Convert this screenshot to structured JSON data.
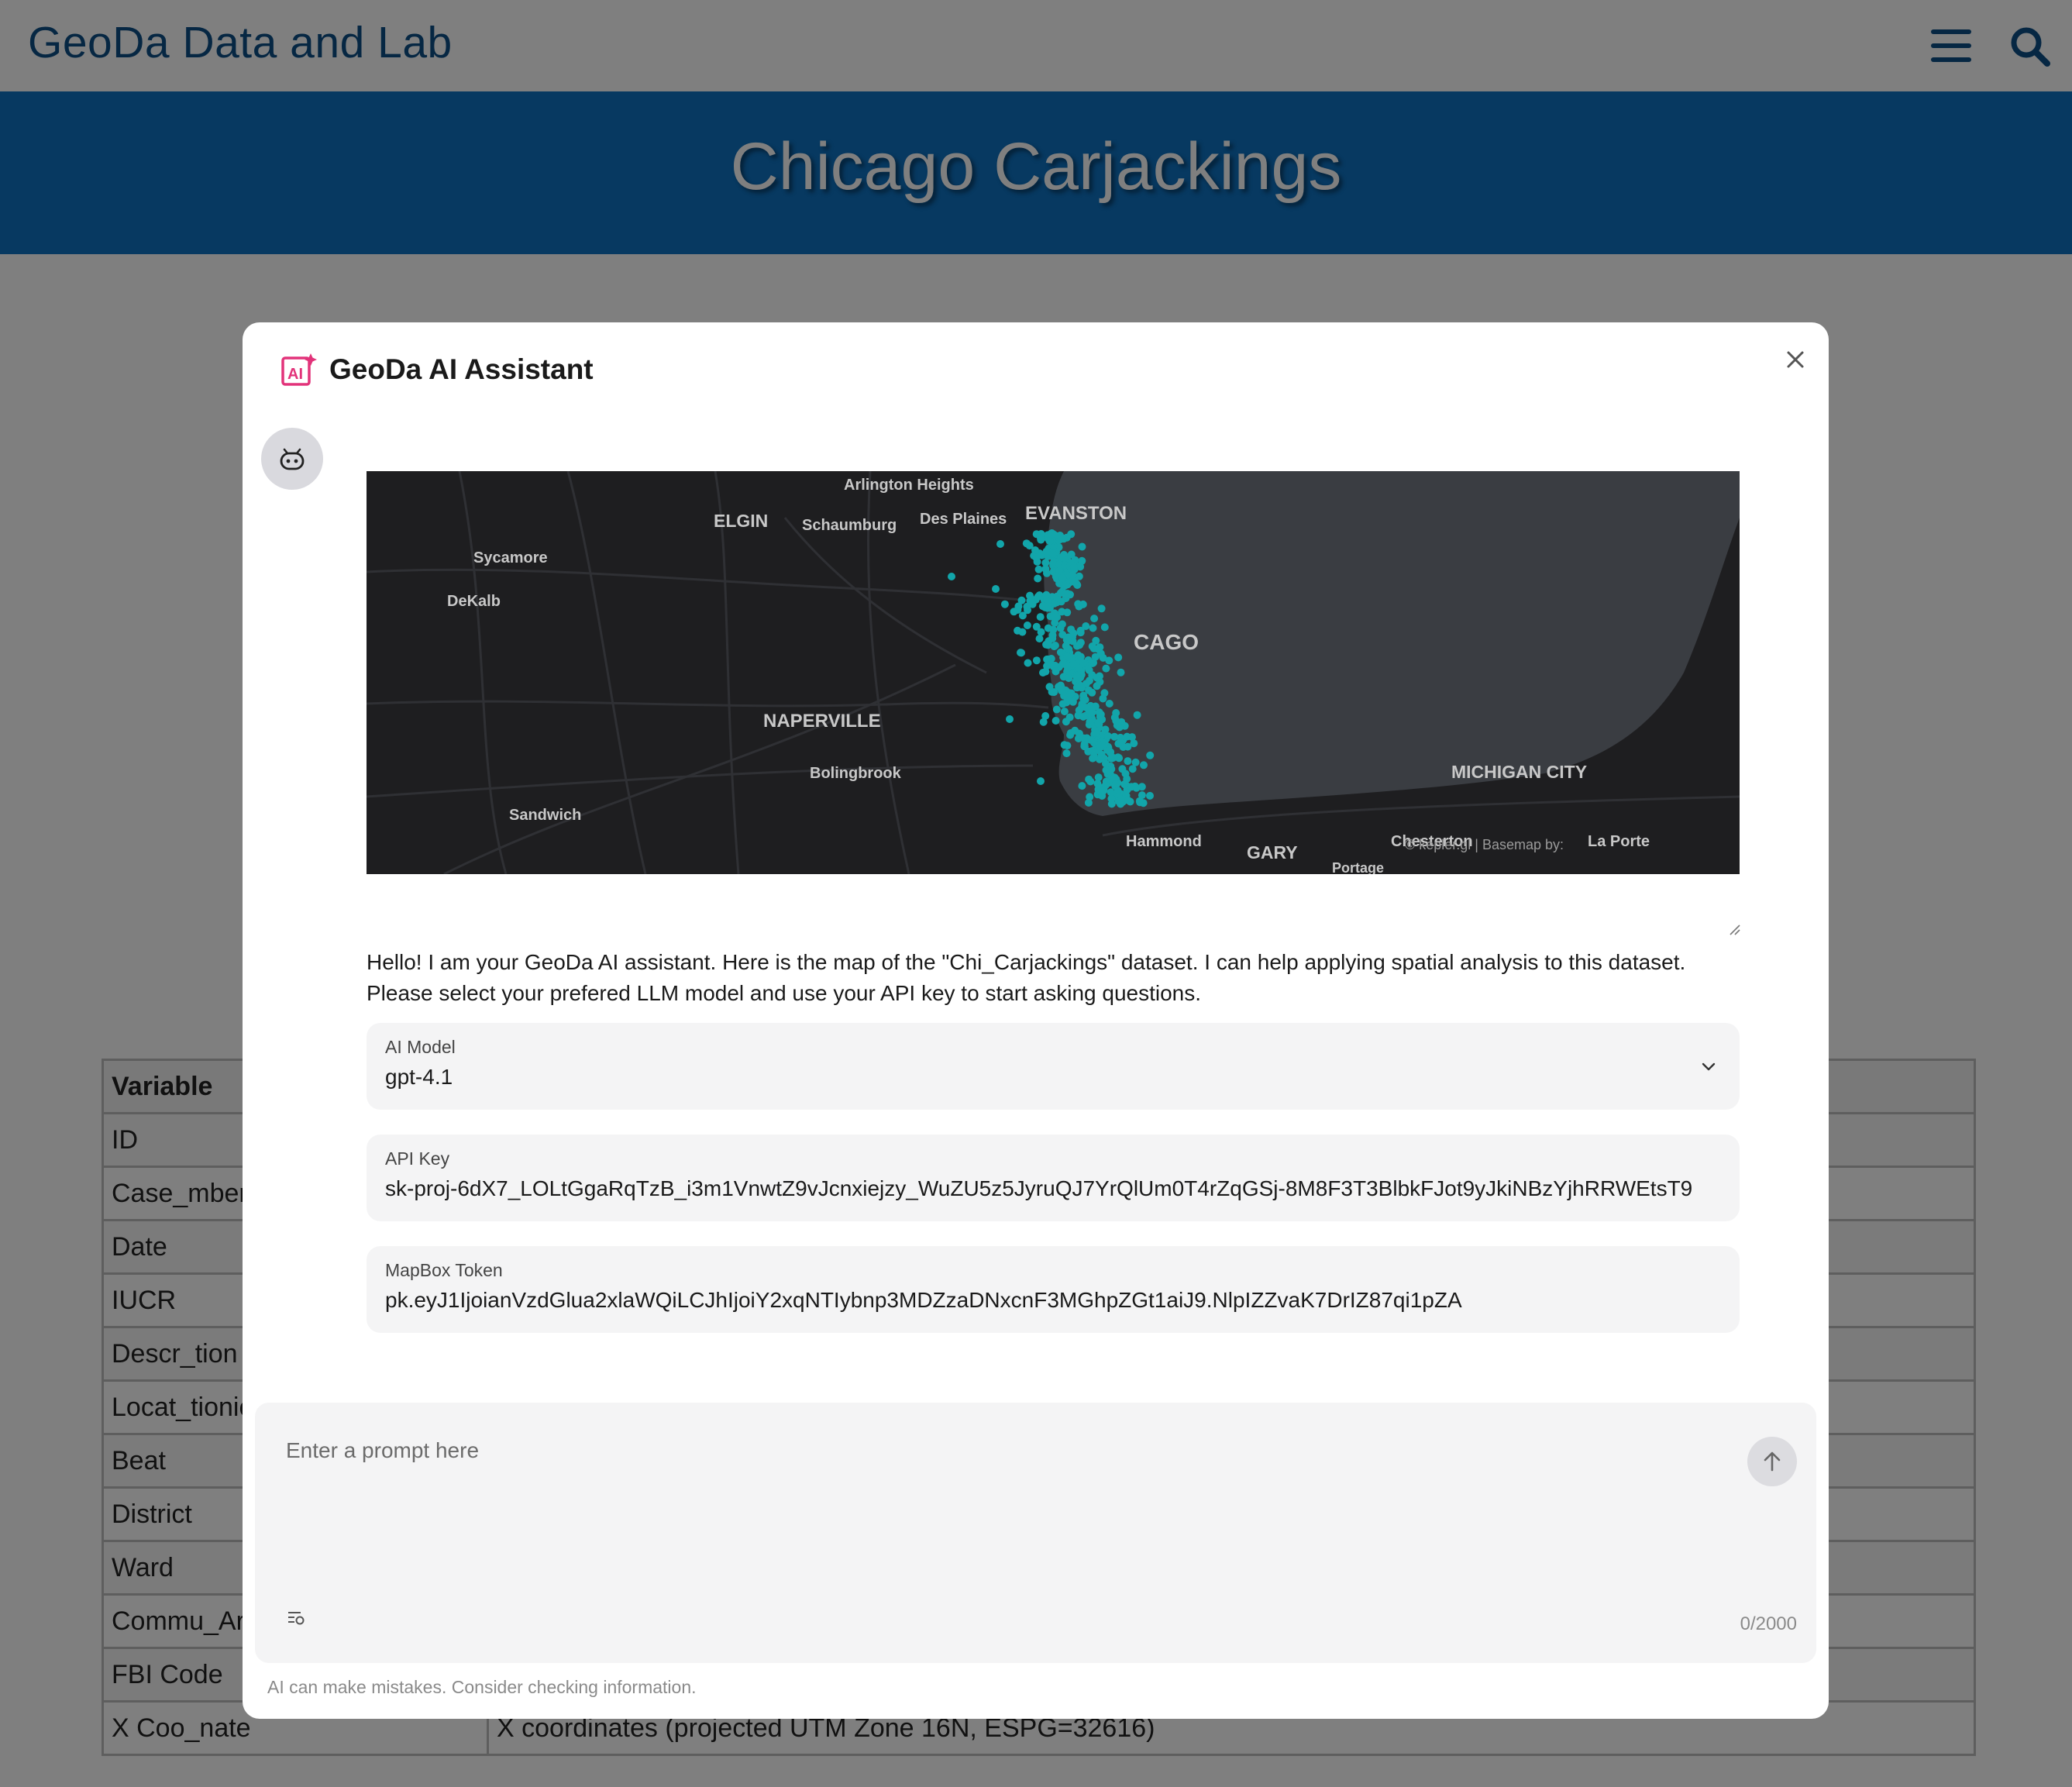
{
  "site": {
    "title": "GeoDa Data and Lab",
    "menu_icon": "hamburger-icon",
    "search_icon": "magnifier-icon",
    "header_color": "#0c4e86",
    "hero_color": "#0e72c2"
  },
  "page": {
    "heading": "Chicago Carjackings"
  },
  "variable_table": {
    "header": [
      "Variable",
      ""
    ],
    "rows": [
      [
        "ID",
        ""
      ],
      [
        "Case_mber",
        ""
      ],
      [
        "Date",
        ""
      ],
      [
        "IUCR",
        ""
      ],
      [
        "Descr_tion",
        ""
      ],
      [
        "Locat_tionic",
        ""
      ],
      [
        "Beat",
        ""
      ],
      [
        "District",
        ""
      ],
      [
        "Ward",
        ""
      ],
      [
        "Commu_Are",
        ""
      ],
      [
        "FBI Code",
        ""
      ],
      [
        "X Coo_nate",
        "X coordinates (projected UTM Zone 16N, ESPG=32616)"
      ]
    ]
  },
  "assistant": {
    "title": "GeoDa AI Assistant",
    "logo_icon": "ai-sparkle-icon",
    "logo_color": "#e2337a",
    "close_icon": "close-icon",
    "avatar_icon": "robot-icon",
    "map": {
      "labels": {
        "arlington_heights": "Arlington Heights",
        "elgin": "ELGIN",
        "schaumburg": "Schaumburg",
        "des_plaines": "Des Plaines",
        "evanston": "EVANSTON",
        "sycamore": "Sycamore",
        "dekalb": "DeKalb",
        "chicago": "CAGO",
        "naperville": "NAPERVILLE",
        "bolingbrook": "Bolingbrook",
        "michigan_city": "MICHIGAN CITY",
        "sandwich": "Sandwich",
        "hammond": "Hammond",
        "gary": "GARY",
        "chesterton": "Chesterton",
        "la_porte": "La Porte",
        "portage": "Portage"
      },
      "attribution": "© kepler.gl | Basemap by:",
      "point_color": "#12a5aa"
    },
    "greeting": "Hello! I am your GeoDa AI assistant. Here is the map of the \"Chi_Carjackings\" dataset. I can help applying spatial analysis to this dataset. Please select your prefered LLM model and use your API key to start asking questions.",
    "model_field": {
      "label": "AI Model",
      "value": "gpt-4.1",
      "icon": "chevron-down-icon"
    },
    "api_key_field": {
      "label": "API Key",
      "value": "sk-proj-6dX7_LOLtGgaRqTzB_i3m1VnwtZ9vJcnxiejzy_WuZU5z5JyruQJ7YrQlUm0T4rZqGSj-8M8F3T3BlbkFJot9yJkiNBzYjhRRWEtsT9"
    },
    "mapbox_field": {
      "label": "MapBox Token",
      "value": "pk.eyJ1IjoianVzdGlua2xlaWQiLCJhIjoiY2xqNTIybnp3MDZzaDNxcnF3MGhpZGt1aiJ9.NlpIZZvaK7DrIZ87qi1pZA"
    },
    "prompt": {
      "placeholder": "Enter a prompt here",
      "char_count": "0/2000",
      "send_icon": "arrow-up-icon",
      "history_icon": "history-list-icon"
    },
    "disclaimer": "AI can make mistakes. Consider checking information."
  }
}
